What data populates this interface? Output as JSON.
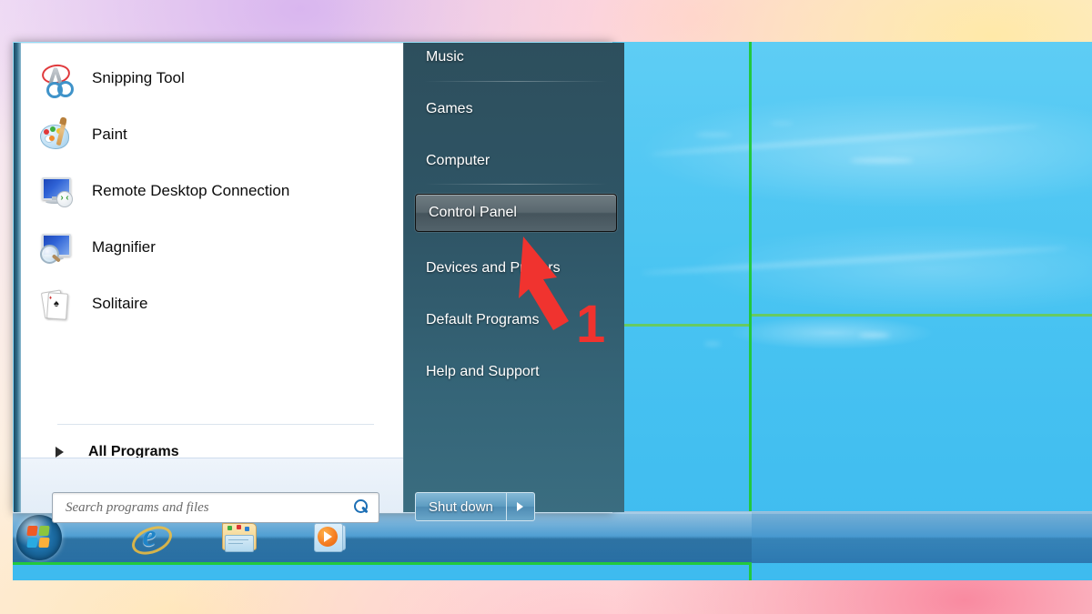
{
  "desktop": {
    "wallpaper_color": "#49c4f2",
    "annotation_color": "#22c93e"
  },
  "annotation": {
    "step_number": "1",
    "arrow_color": "#f0332f",
    "points_to": "Control Panel"
  },
  "start_menu": {
    "left_panel": {
      "programs": [
        {
          "label": "Snipping Tool",
          "icon": "snipping-tool-icon"
        },
        {
          "label": "Paint",
          "icon": "paint-icon"
        },
        {
          "label": "Remote Desktop Connection",
          "icon": "remote-desktop-icon"
        },
        {
          "label": "Magnifier",
          "icon": "magnifier-icon"
        },
        {
          "label": "Solitaire",
          "icon": "solitaire-icon"
        }
      ],
      "all_programs": {
        "label": "All Programs",
        "icon": "chevron-right-icon"
      },
      "search": {
        "placeholder": "Search programs and files",
        "value": "",
        "icon": "search-icon"
      }
    },
    "right_panel": {
      "items": [
        {
          "label": "Music",
          "selected": false,
          "clipped": true
        },
        {
          "label": "Games",
          "selected": false
        },
        {
          "label": "Computer",
          "selected": false
        },
        {
          "label": "Control Panel",
          "selected": true
        },
        {
          "label": "Devices and Printers",
          "selected": false
        },
        {
          "label": "Default Programs",
          "selected": false
        },
        {
          "label": "Help and Support",
          "selected": false
        }
      ],
      "shutdown": {
        "label": "Shut down",
        "arrow_icon": "chevron-right-icon"
      }
    }
  },
  "taskbar": {
    "start_button": {
      "label": "Start",
      "icon": "windows-orb-icon"
    },
    "pinned": [
      {
        "name": "Internet Explorer",
        "icon": "internet-explorer-icon"
      },
      {
        "name": "Windows Explorer",
        "icon": "folder-icon"
      },
      {
        "name": "Windows Media Player",
        "icon": "media-player-icon"
      }
    ]
  }
}
